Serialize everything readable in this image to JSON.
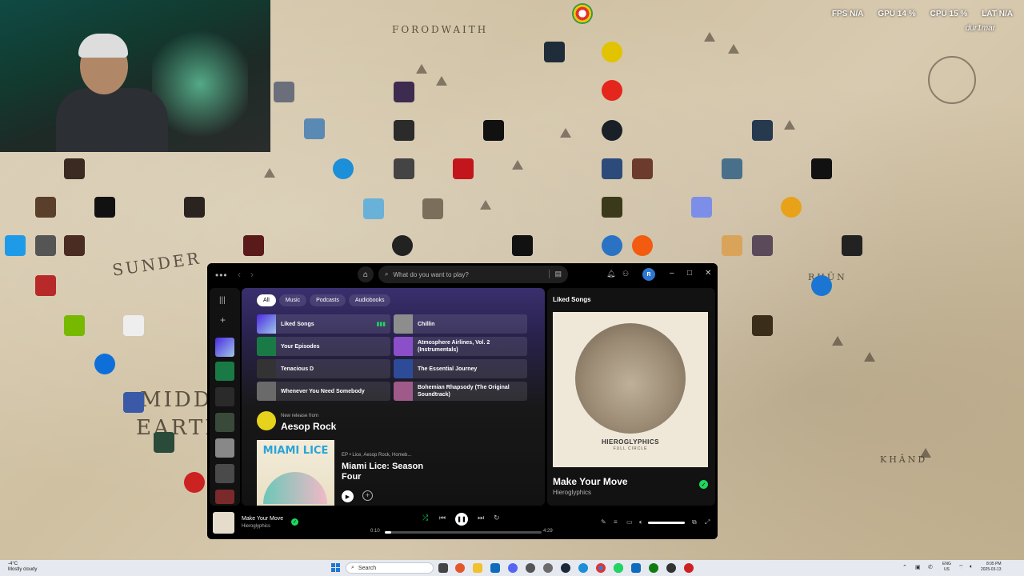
{
  "overlay": {
    "fps": "FPS N/A",
    "cpu": "GPU 14 %",
    "cpu2": "CPU 15 %",
    "lat": "LAT N/A",
    "watermark": "dur1mar"
  },
  "spotify": {
    "search_placeholder": "What do you want to play?",
    "avatar_letter": "R",
    "filters": [
      "All",
      "Music",
      "Podcasts",
      "Audiobooks"
    ],
    "shortcuts": [
      {
        "label": "Liked Songs",
        "color": "#5b3fd6"
      },
      {
        "label": "Chillin",
        "color": "#8d8d8d"
      },
      {
        "label": "Your Episodes",
        "color": "#1a7a45"
      },
      {
        "label": "Atmosphere Airlines, Vol. 2 (Instrumentals)",
        "color": "#8a4fc9"
      },
      {
        "label": "Tenacious D",
        "color": "#333333"
      },
      {
        "label": "The Essential Journey",
        "color": "#2e4b9a"
      },
      {
        "label": "Whenever You Need Somebody",
        "color": "#6a6a6a"
      },
      {
        "label": "Bohemian Rhapsody (The Original Soundtrack)",
        "color": "#a05a8a"
      }
    ],
    "new_release": {
      "small": "New release from",
      "artist": "Aesop Rock",
      "cover_text": "MIAMI LICE",
      "meta": "EP • Lice, Aesop Rock, Homeb...",
      "title": "Miami Lice: Season Four"
    },
    "now_playing_panel": {
      "header": "Liked Songs",
      "album_caption": "HIEROGLYPHICS",
      "album_sub": "FULL CIRCLE",
      "title": "Make Your Move",
      "artist": "Hieroglyphics"
    },
    "player": {
      "title": "Make Your Move",
      "artist": "Hieroglyphics",
      "elapsed": "0:10",
      "duration": "4:29",
      "progress": 0.04,
      "volume": 1.0
    }
  },
  "taskbar": {
    "weather_temp": "-4°C",
    "weather_desc": "Mostly cloudy",
    "search": "Search",
    "lang1": "ENG",
    "lang2": "US",
    "time": "8:05 PM",
    "date": "2025-03-13"
  },
  "desktop": {
    "map_labels": [
      "FORODWAITH",
      "SUNDER",
      "MIDDLE",
      "EARTH",
      "KHÂND",
      "RHÛN"
    ]
  }
}
